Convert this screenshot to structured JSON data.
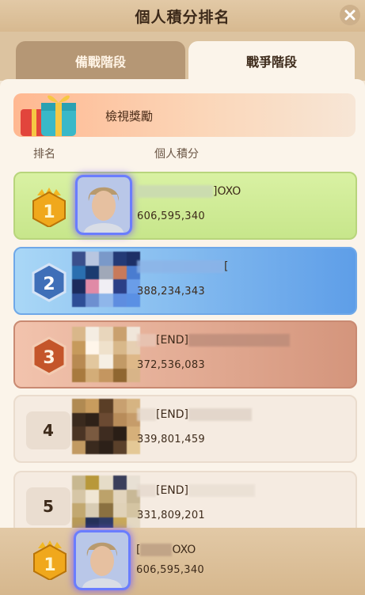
{
  "header": {
    "title": "個人積分排名"
  },
  "tabs": [
    {
      "label": "備戰階段",
      "active": false
    },
    {
      "label": "戰爭階段",
      "active": true
    }
  ],
  "reward": {
    "label": "檢視獎勵"
  },
  "columns": {
    "rank": "排名",
    "score": "個人積分"
  },
  "rows": [
    {
      "rank": "1",
      "name": "]OXO",
      "score": "606,595,340"
    },
    {
      "rank": "2",
      "name": "[",
      "score": "388,234,343"
    },
    {
      "rank": "3",
      "name": "[END]",
      "score": "372,536,083"
    },
    {
      "rank": "4",
      "name": "[END]",
      "score": "339,801,459"
    },
    {
      "rank": "5",
      "name": "[END]",
      "score": "331,809,201"
    }
  ],
  "me": {
    "rank": "1",
    "name_prefix": "[",
    "name": "OXO",
    "score": "606,595,340"
  },
  "colors": {
    "header": "#d7b990",
    "rank1": "#c7e68b",
    "rank2": "#5e9ee8",
    "rank3": "#d4957c",
    "plain": "#f5ebe1"
  }
}
